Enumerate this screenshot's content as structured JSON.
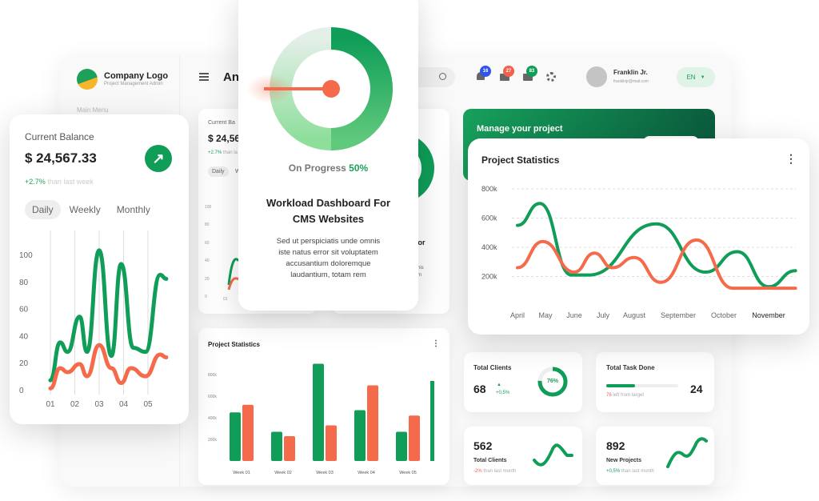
{
  "colors": {
    "green": "#0f9d58",
    "orange": "#f46a4b",
    "light_green": "#86dd97"
  },
  "sidebar": {
    "logo_title": "Company Logo",
    "logo_subtitle": "Project Management Admin",
    "section": "Main Menu"
  },
  "header": {
    "title": "An",
    "menu_icon": "hamburger-icon",
    "search_icon": "search-icon",
    "notifications": [
      {
        "icon": "bell-icon",
        "count": "16",
        "color": "#2f55e8"
      },
      {
        "icon": "mail-icon",
        "count": "27",
        "color": "#f0604a"
      },
      {
        "icon": "folder-icon",
        "count": "83",
        "color": "#0f9d58"
      }
    ],
    "user_name": "Franklin Jr.",
    "user_email": "franklinjr@mail.com",
    "language": "EN"
  },
  "back_balance": {
    "label": "Current Ba",
    "amount": "$ 24,56",
    "change": "+2.7%",
    "change_text": "than la",
    "tab": "Daily",
    "tab2": "W",
    "yticks": [
      "100",
      "80",
      "60",
      "40",
      "20",
      "0"
    ],
    "xtick": "01"
  },
  "back_workload": {
    "title": "d For",
    "lines": [
      "mnis",
      "tem",
      "e"
    ]
  },
  "banner": {
    "title": "Manage your project"
  },
  "bar_chart": {
    "title": "Project Statistics",
    "menu_icon": "more-vertical-icon"
  },
  "stats": {
    "total_clients": {
      "label": "Total Clients",
      "value": "68",
      "change": "+0,5%",
      "ring": "76%",
      "ring_value": 76
    },
    "task_done": {
      "label": "Total Task Done",
      "value": "24",
      "left": "76",
      "left_text": "left from target",
      "progress": 40
    },
    "clients2": {
      "value": "562",
      "label": "Total Clients",
      "change": "-2%",
      "change_text": "than last month"
    },
    "projects": {
      "value": "892",
      "label": "New Projects",
      "change": "+0,5%",
      "change_text": "than last month"
    }
  },
  "left_card": {
    "label": "Current Balance",
    "amount": "$ 24,567.33",
    "change": "+2.7%",
    "change_text": "than last week",
    "tabs": [
      "Daily",
      "Weekly",
      "Monthly"
    ],
    "active_tab": 0,
    "arrow_icon": "arrow-up-right-icon"
  },
  "center_card": {
    "progress_label": "On Progress",
    "progress_value": "50%",
    "progress": 50,
    "title_line1": "Workload Dashboard For",
    "title_line2": "CMS Websites",
    "body": [
      "Sed ut perspiciatis unde omnis",
      "iste natus error sit voluptatem",
      "accusantium doloremque",
      "laudantium, totam rem"
    ]
  },
  "right_card": {
    "title": "Project Statistics",
    "menu_icon": "more-vertical-icon"
  },
  "chart_data": [
    {
      "type": "line",
      "ylim": [
        0,
        100
      ],
      "yticks": [
        "0",
        "20",
        "40",
        "60",
        "80",
        "100"
      ],
      "categories": [
        "01",
        "02",
        "03",
        "04",
        "05"
      ],
      "series": [
        {
          "color": "#0f9d58",
          "points": [
            [
              1,
              7
            ],
            [
              1.4,
              35
            ],
            [
              1.7,
              28
            ],
            [
              2.2,
              54
            ],
            [
              2.5,
              28
            ],
            [
              3,
              103
            ],
            [
              3.5,
              25
            ],
            [
              3.9,
              93
            ],
            [
              4.4,
              31
            ],
            [
              4.9,
              28
            ],
            [
              5.5,
              85
            ],
            [
              5.75,
              82
            ]
          ]
        },
        {
          "color": "#f46a4b",
          "points": [
            [
              1,
              1
            ],
            [
              1.4,
              16
            ],
            [
              1.7,
              13
            ],
            [
              2.2,
              19
            ],
            [
              2.5,
              10
            ],
            [
              3,
              33
            ],
            [
              3.5,
              16
            ],
            [
              3.9,
              5
            ],
            [
              4.3,
              16
            ],
            [
              4.9,
              10
            ],
            [
              5.5,
              26
            ],
            [
              5.75,
              24
            ]
          ]
        }
      ]
    },
    {
      "type": "bar",
      "categories": [
        "Week 01",
        "Week 02",
        "Week 03",
        "Week 04",
        "Week 05"
      ],
      "yticks": [
        "200k",
        "400k",
        "600k",
        "800k"
      ],
      "ylim": [
        0,
        900000
      ],
      "series": [
        {
          "color": "#0f9d58",
          "values": [
            450000,
            270000,
            900000,
            470000,
            270000
          ]
        },
        {
          "color": "#f46a4b",
          "values": [
            520000,
            230000,
            330000,
            700000,
            420000
          ]
        }
      ]
    },
    {
      "type": "line",
      "categories": [
        "April",
        "May",
        "June",
        "July",
        "August",
        "September",
        "October",
        "November"
      ],
      "yticks": [
        "200k",
        "400k",
        "600k",
        "800k"
      ],
      "ylim": [
        0,
        900000
      ],
      "grid": true,
      "series": [
        {
          "color": "#0f9d58",
          "points": [
            [
              0,
              550000
            ],
            [
              0.8,
              700000
            ],
            [
              1.9,
              210000
            ],
            [
              2.5,
              210000
            ],
            [
              4.5,
              560000
            ],
            [
              5.6,
              230000
            ],
            [
              6.3,
              370000
            ],
            [
              7,
              130000
            ],
            [
              7.6,
              240000
            ]
          ]
        },
        {
          "color": "#f46a4b",
          "points": [
            [
              0,
              260000
            ],
            [
              0.9,
              440000
            ],
            [
              2,
              230000
            ],
            [
              2.7,
              360000
            ],
            [
              3.3,
              260000
            ],
            [
              4,
              330000
            ],
            [
              4.6,
              160000
            ],
            [
              5.4,
              450000
            ],
            [
              6.2,
              120000
            ],
            [
              7.6,
              120000
            ]
          ]
        }
      ]
    }
  ]
}
